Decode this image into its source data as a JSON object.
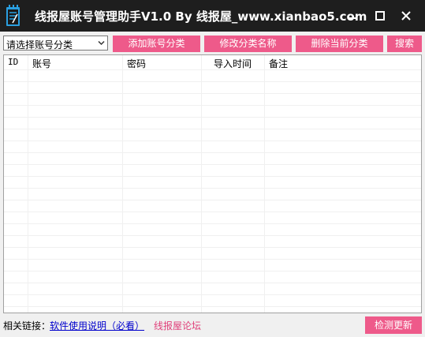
{
  "titlebar": {
    "title": "线报屋账号管理助手V1.0 By 线报屋_www.xianbao5.com"
  },
  "toolbar": {
    "category_select_value": "请选择账号分类",
    "add_category_label": "添加账号分类",
    "rename_category_label": "修改分类名称",
    "delete_category_label": "删除当前分类",
    "search_label": "搜索"
  },
  "table": {
    "columns": [
      "ID",
      "账号",
      "密码",
      "导入时间",
      "备注"
    ],
    "rows": []
  },
  "footer": {
    "links_label": "相关链接：",
    "manual_link": "软件使用说明（必看）",
    "forum_link": "线报屋论坛",
    "check_update_label": "检测更新"
  },
  "colors": {
    "titlebar_bg": "#1e1e1e",
    "accent_pink": "#ee5a8a",
    "link_blue": "#0000cc",
    "link_pink": "#e0407a",
    "icon_blue": "#2a9fe0"
  }
}
